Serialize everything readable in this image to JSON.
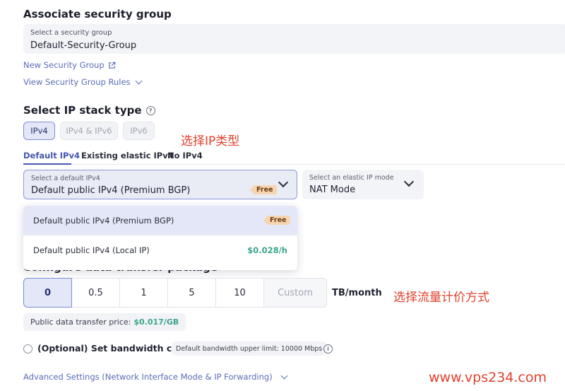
{
  "security_group": {
    "heading": "Associate security group",
    "field_label": "Select a security group",
    "field_value": "Default-Security-Group",
    "new_link": "New Security Group",
    "view_rules": "View Security Group Rules"
  },
  "ip_stack": {
    "heading": "Select IP stack type",
    "options": [
      "IPv4",
      "IPv4 & IPv6",
      "IPv6"
    ],
    "selected": "IPv4",
    "annotation": "选择IP类型"
  },
  "ipv4_tabs": {
    "tabs": [
      "Default IPv4",
      "Existing elastic IPv4",
      "No IPv4"
    ],
    "active": "Default IPv4"
  },
  "default_ipv4_select": {
    "label": "Select a default IPv4",
    "value": "Default public IPv4 (Premium BGP)",
    "badge": "Free"
  },
  "elastic_mode_select": {
    "label": "Select an elastic IP mode",
    "value": "NAT Mode"
  },
  "dropdown": {
    "items": [
      {
        "label": "Default public IPv4 (Premium BGP)",
        "price": "Free"
      },
      {
        "label": "Default public IPv4 (Local IP)",
        "price": "$0.028/h"
      }
    ]
  },
  "transfer": {
    "heading": "Configure data transfer package",
    "options": [
      "0",
      "0.5",
      "1",
      "5",
      "10",
      "Custom"
    ],
    "selected": "0",
    "unit": "TB/month",
    "annotation": "选择流量计价方式",
    "price_label": "Public data transfer price:",
    "price_value": "$0.017/GB"
  },
  "bandwidth": {
    "label": "(Optional) Set bandwidth cap",
    "limit_note": "Default bandwidth upper limit: 10000 Mbps"
  },
  "advanced": {
    "label": "Advanced Settings (Network Interface Mode & IP Forwarding)"
  },
  "watermark": "www.vps234.com",
  "colors": {
    "accent": "#4556b0",
    "annotation": "#e0412e",
    "price_green": "#3ba58c",
    "free_badge": "#f6d6b2"
  }
}
